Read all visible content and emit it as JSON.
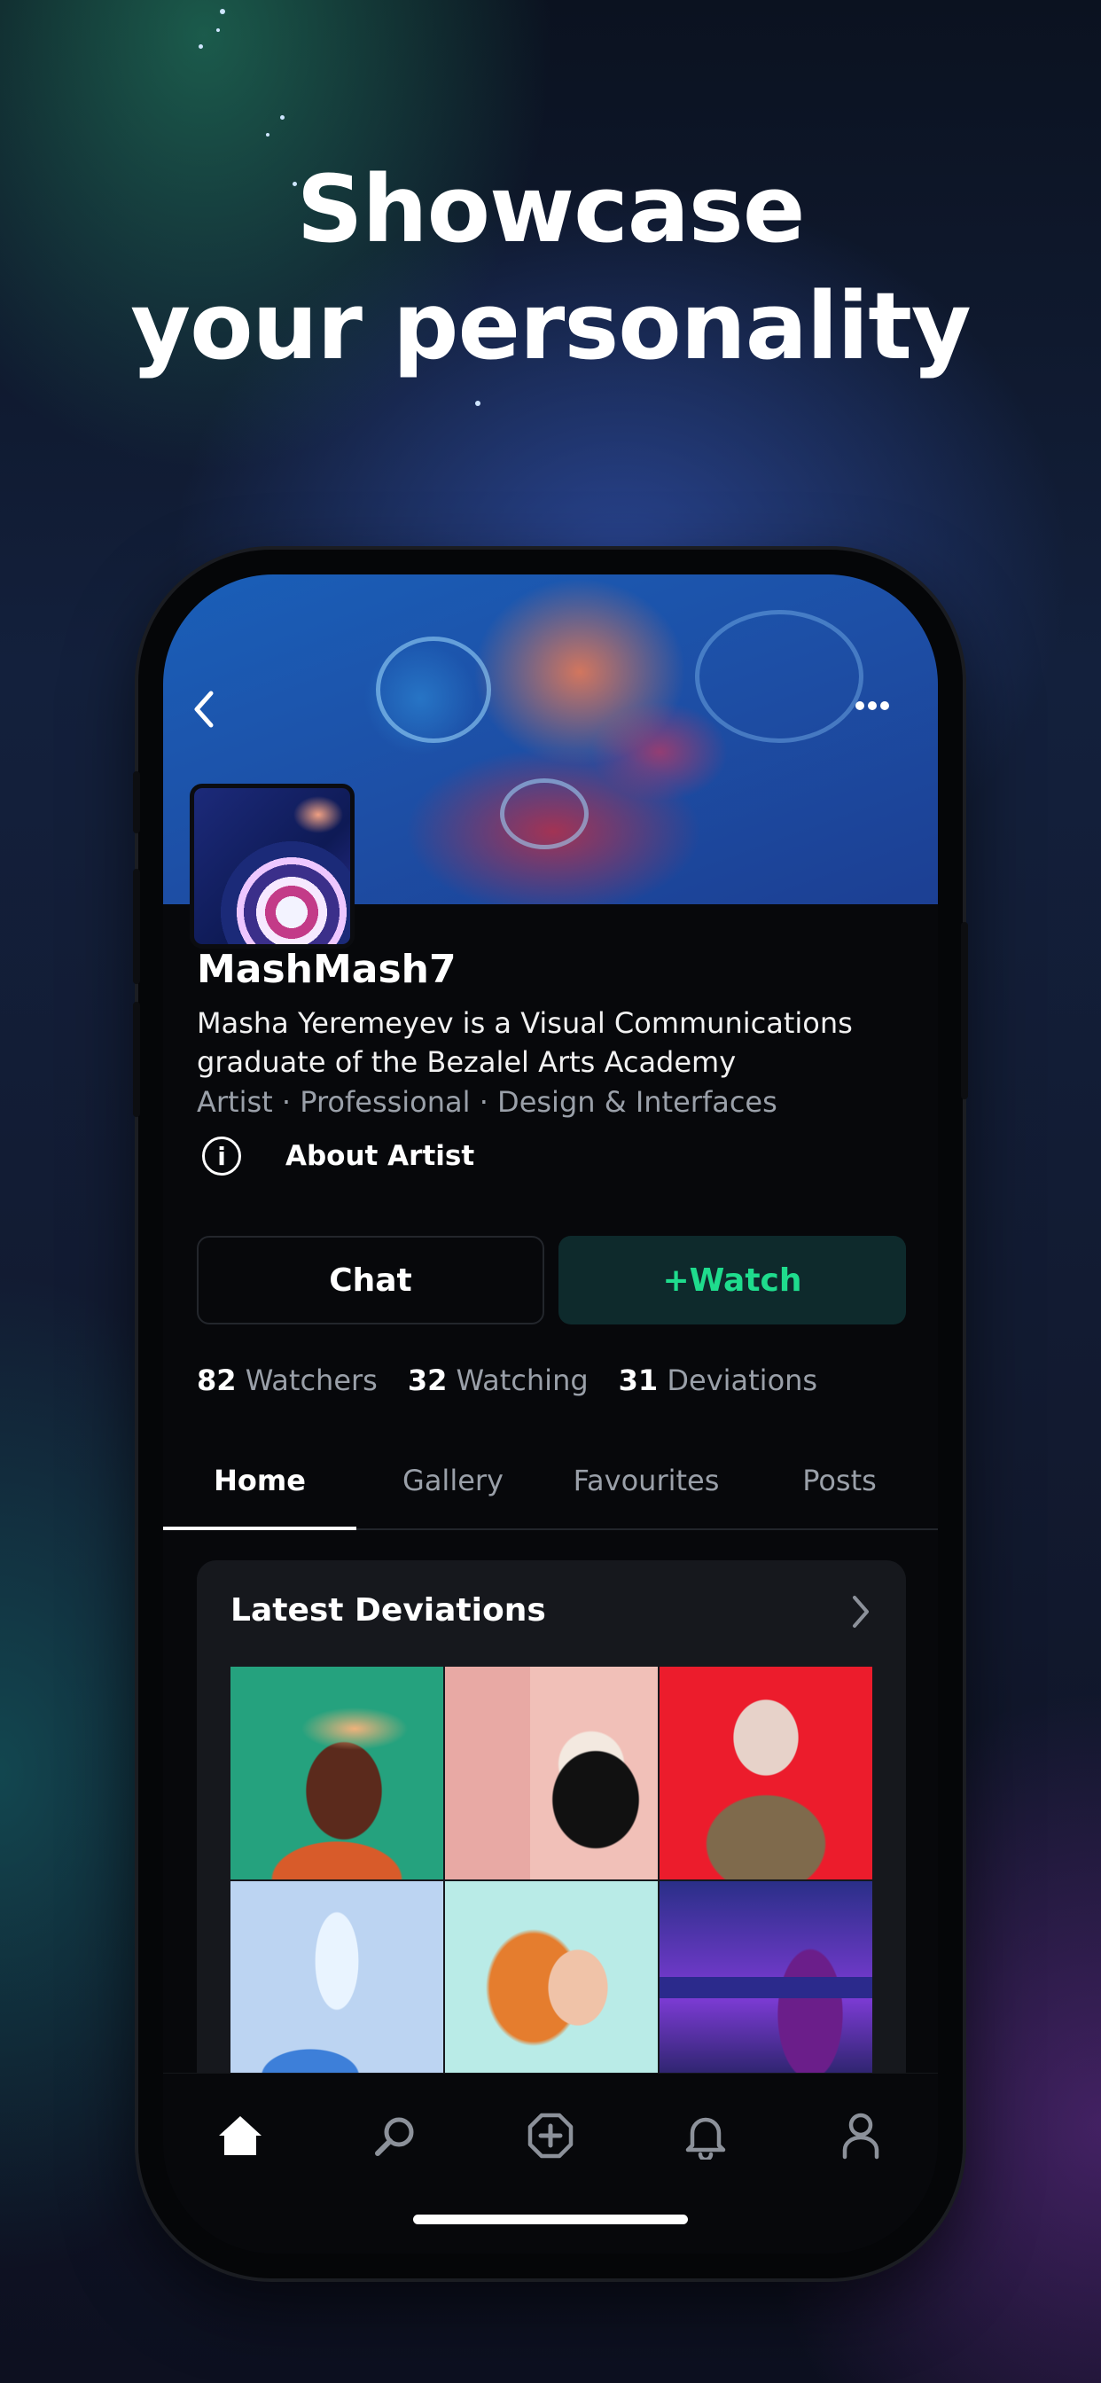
{
  "headline": {
    "line1": "Showcase",
    "line2": "your personality"
  },
  "profile": {
    "username": "MashMash7",
    "bio": "Masha Yeremeyev is a Visual Communications graduate of the Bezalel Arts Academy",
    "tags": "Artist · Professional · Design & Interfaces",
    "about_label": "About Artist",
    "info_glyph": "i"
  },
  "actions": {
    "chat": "Chat",
    "watch": "+Watch",
    "watch_color": "#1fdc8d"
  },
  "stats": [
    {
      "count": "82",
      "label": "Watchers"
    },
    {
      "count": "32",
      "label": "Watching"
    },
    {
      "count": "31",
      "label": "Deviations"
    }
  ],
  "tabs": [
    "Home",
    "Gallery",
    "Favourites",
    "Posts"
  ],
  "active_tab": "Home",
  "latest": {
    "title": "Latest Deviations",
    "chevron": "›"
  },
  "nav": {
    "back_glyph": "‹",
    "more_glyph": "•••"
  },
  "tabbar_icons": [
    "home-icon",
    "search-icon",
    "create-icon",
    "bell-icon",
    "profile-icon"
  ]
}
